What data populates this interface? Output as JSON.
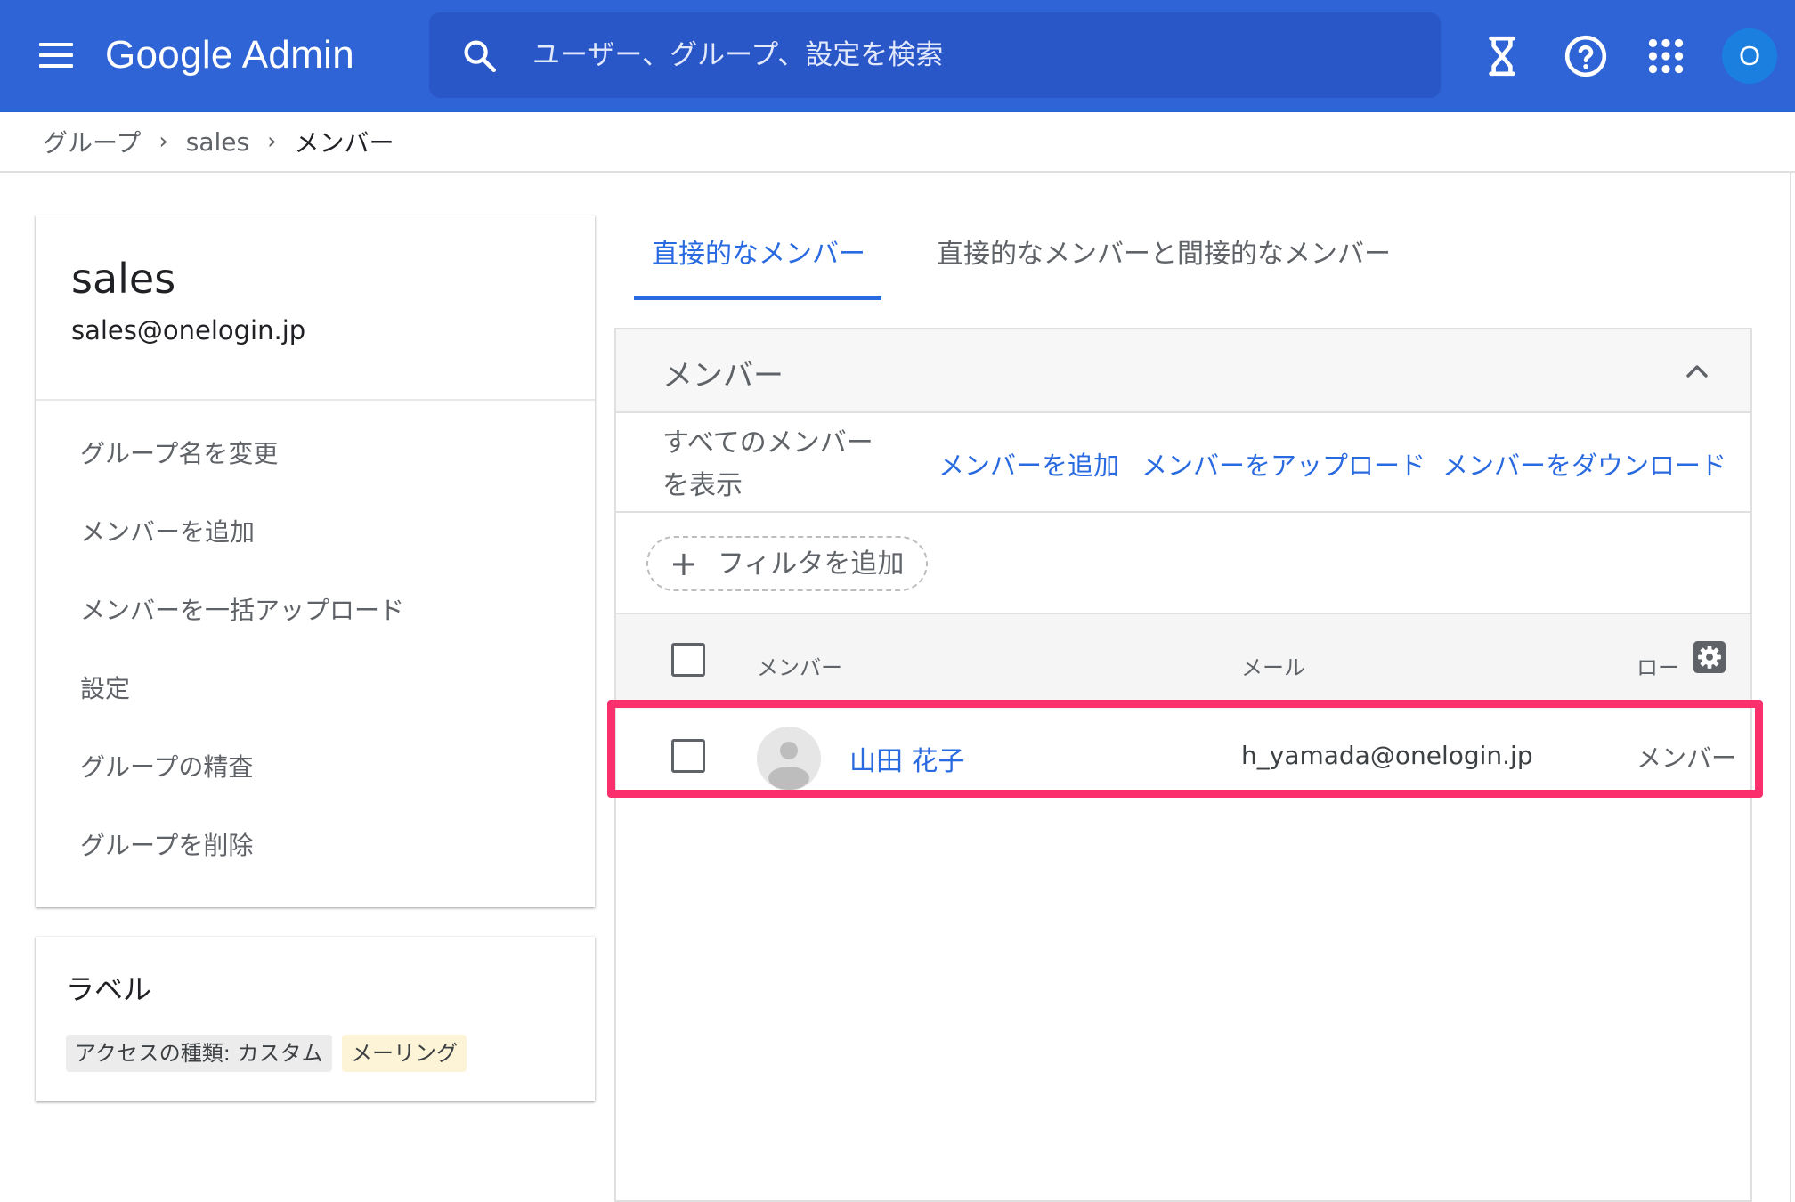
{
  "header": {
    "brand": "Google Admin",
    "search_placeholder": "ユーザー、グループ、設定を検索",
    "icons": [
      "menu-icon",
      "search-icon",
      "hourglass-icon",
      "help-icon",
      "apps-grid-icon"
    ],
    "avatar_initial": "O",
    "colors": {
      "bar": "#2f64d6",
      "search": "#2957c7",
      "avatar": "#1b7fe0"
    }
  },
  "breadcrumb": {
    "items": [
      "グループ",
      "sales",
      "メンバー"
    ],
    "separator": "›"
  },
  "group": {
    "name": "sales",
    "email": "sales@onelogin.jp",
    "actions": [
      "グループ名を変更",
      "メンバーを追加",
      "メンバーを一括アップロード",
      "設定",
      "グループの精査",
      "グループを削除"
    ]
  },
  "labels": {
    "title": "ラベル",
    "chips": [
      "アクセスの種類: カスタム",
      "メーリング"
    ]
  },
  "tabs": {
    "active": "直接的なメンバー",
    "inactive": "直接的なメンバーと間接的なメンバー",
    "accent": "#2a6ae0"
  },
  "members_panel": {
    "title": "メンバー",
    "show_all": "すべてのメンバーを表示",
    "links": [
      "メンバーを追加",
      "メンバーをアップロード",
      "メンバーをダウンロード"
    ],
    "filter_label": "フィルタを追加",
    "columns": [
      "メンバー",
      "メール",
      "ロー"
    ],
    "rows": [
      {
        "name": "山田 花子",
        "email": "h_yamada@onelogin.jp",
        "role": "メンバー"
      }
    ],
    "highlight_color": "#fb2f6c"
  }
}
